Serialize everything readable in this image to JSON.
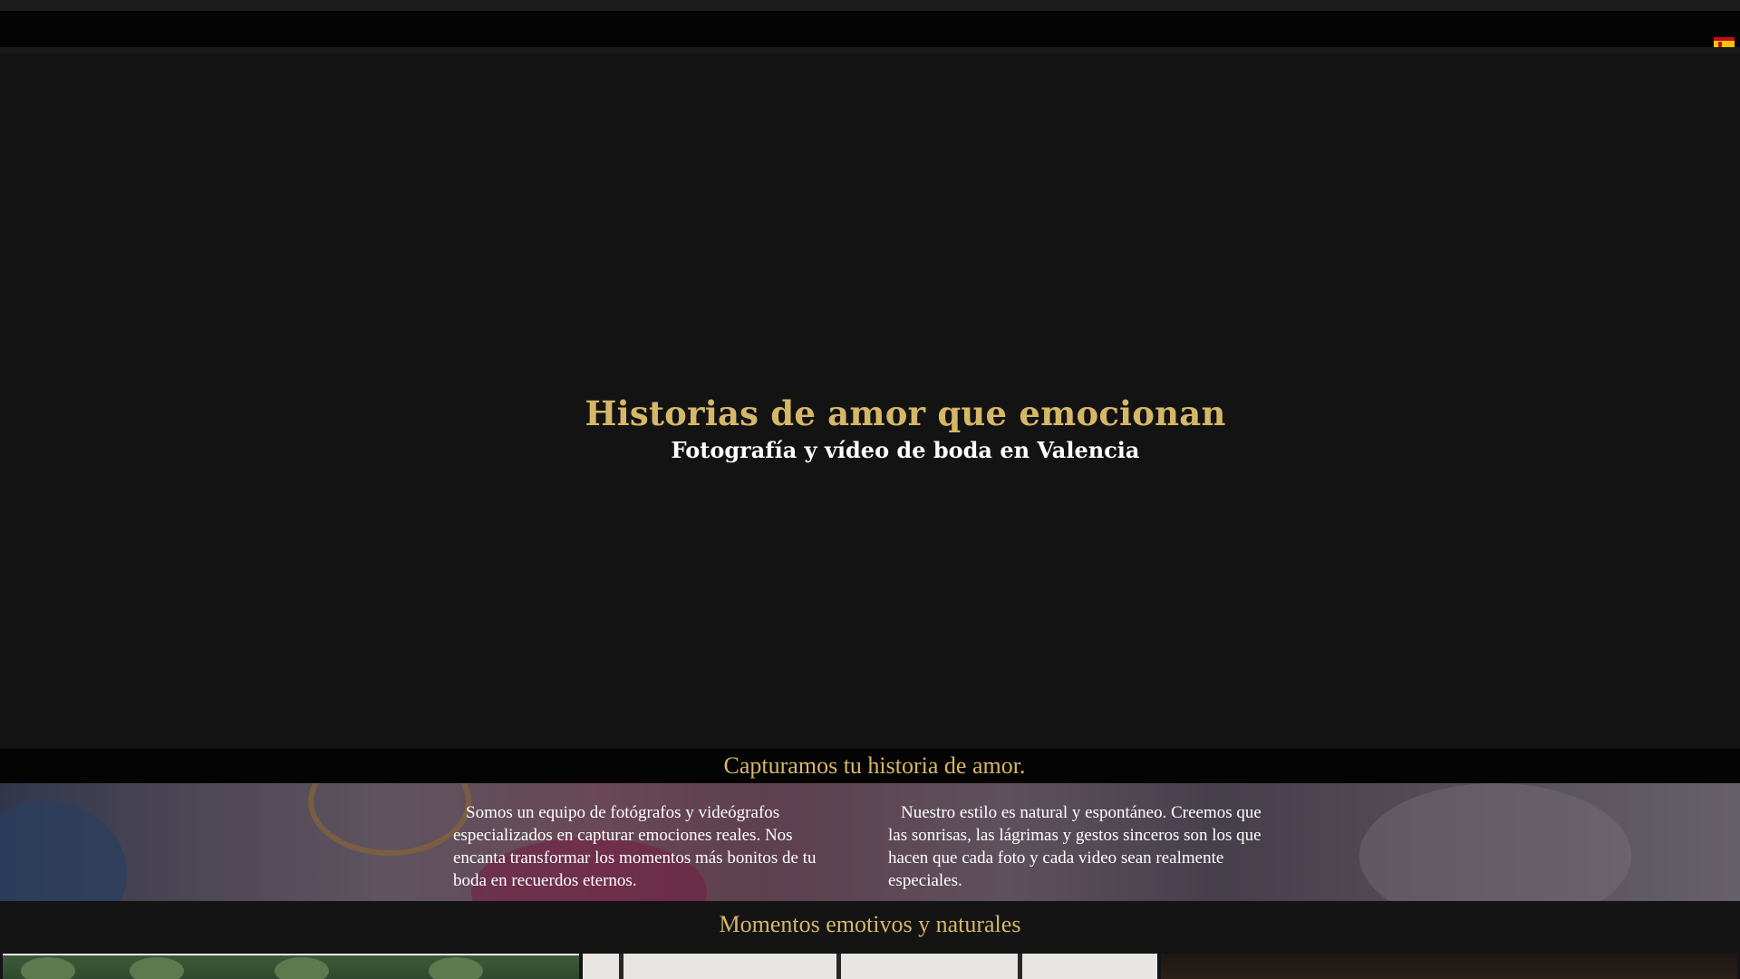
{
  "header": {
    "language_icon": "spain-flag-icon",
    "language_label": "ES"
  },
  "hero": {
    "title": "Historias de amor que emocionan",
    "subtitle": "Fotografía y vídeo de boda en Valencia"
  },
  "intro": {
    "heading": "Capturamos tu historia de amor.",
    "paragraph_left": "Somos un equipo de fotógrafos y videógrafos especializados en capturar emociones reales. Nos encanta transformar los momentos más bonitos de tu boda en recuerdos eternos.",
    "paragraph_right": "Nuestro estilo es natural y espontáneo. Creemos que las sonrisas, las lágrimas y gestos sinceros son los que hacen que cada foto y cada video sean realmente especiales."
  },
  "moments": {
    "heading": "Momentos emotivos y naturales"
  },
  "colors": {
    "accent_gold": "#d6b767",
    "background_dark": "#131314",
    "header_black": "#040404",
    "text_white": "#ffffff"
  }
}
